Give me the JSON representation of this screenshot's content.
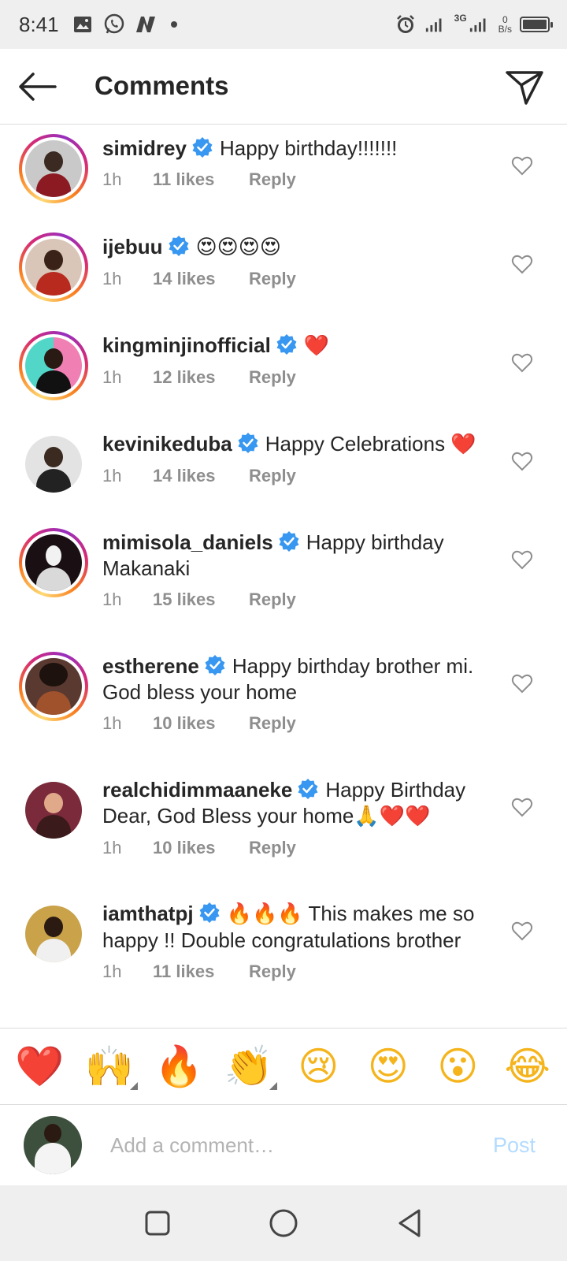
{
  "status_bar": {
    "time": "8:41",
    "network_type": "3G",
    "speed_value": "0",
    "speed_unit": "B/s",
    "icons": [
      "image-icon",
      "whatsapp-icon",
      "n-app-icon",
      "alarm-icon",
      "signal-icon",
      "battery-icon"
    ]
  },
  "header": {
    "title": "Comments",
    "back_icon": "arrow-left-icon",
    "share_icon": "send-icon"
  },
  "comments": [
    {
      "username": "simidrey",
      "verified": true,
      "text": "Happy birthday!!!!!!!",
      "emojis": "",
      "time": "1h",
      "likes": "11 likes",
      "reply": "Reply",
      "story_ring": true
    },
    {
      "username": "ijebuu",
      "verified": true,
      "text": "",
      "emojis": "😍😍😍😍",
      "time": "1h",
      "likes": "14 likes",
      "reply": "Reply",
      "story_ring": true
    },
    {
      "username": "kingminjinofficial",
      "verified": true,
      "text": "",
      "emojis": "❤️",
      "time": "1h",
      "likes": "12 likes",
      "reply": "Reply",
      "story_ring": true
    },
    {
      "username": "kevinikeduba",
      "verified": true,
      "text": "Happy Celebrations",
      "emojis": "❤️",
      "time": "1h",
      "likes": "14 likes",
      "reply": "Reply",
      "story_ring": false
    },
    {
      "username": "mimisola_daniels",
      "verified": true,
      "text": "Happy birthday Makanaki",
      "emojis": "",
      "time": "1h",
      "likes": "15 likes",
      "reply": "Reply",
      "story_ring": true
    },
    {
      "username": "estherene",
      "verified": true,
      "text": "Happy birthday brother mi. God bless your home",
      "emojis": "",
      "time": "1h",
      "likes": "10 likes",
      "reply": "Reply",
      "story_ring": true
    },
    {
      "username": "realchidimmaaneke",
      "verified": true,
      "text": "Happy Birthday Dear, God Bless your home",
      "emojis": "🙏❤️❤️",
      "time": "1h",
      "likes": "10 likes",
      "reply": "Reply",
      "story_ring": false
    },
    {
      "username": "iamthatpj",
      "verified": true,
      "text": "This makes me so happy !! Double congratulations brother",
      "emojis_before": "🔥🔥🔥",
      "time": "1h",
      "likes": "11 likes",
      "reply": "Reply",
      "story_ring": false
    }
  ],
  "emoji_bar": [
    {
      "emoji": "❤️",
      "name": "red-heart",
      "has_variants": false
    },
    {
      "emoji": "🙌",
      "name": "raising-hands",
      "has_variants": true
    },
    {
      "emoji": "🔥",
      "name": "fire",
      "has_variants": false
    },
    {
      "emoji": "👏",
      "name": "clapping-hands",
      "has_variants": true
    },
    {
      "emoji": "😢",
      "name": "crying-face",
      "has_variants": false
    },
    {
      "emoji": "😍",
      "name": "heart-eyes",
      "has_variants": false
    },
    {
      "emoji": "😮",
      "name": "surprised-face",
      "has_variants": false
    },
    {
      "emoji": "😂",
      "name": "tears-of-joy",
      "has_variants": false
    }
  ],
  "composer": {
    "placeholder": "Add a comment…",
    "post_label": "Post"
  },
  "nav_bar": {
    "icons": [
      "recent-apps-icon",
      "home-icon",
      "back-icon"
    ]
  },
  "colors": {
    "verified_blue": "#3897f0",
    "heart_red": "#e0132b",
    "post_disabled": "#b3dbff",
    "meta_gray": "#8e8e8e"
  }
}
